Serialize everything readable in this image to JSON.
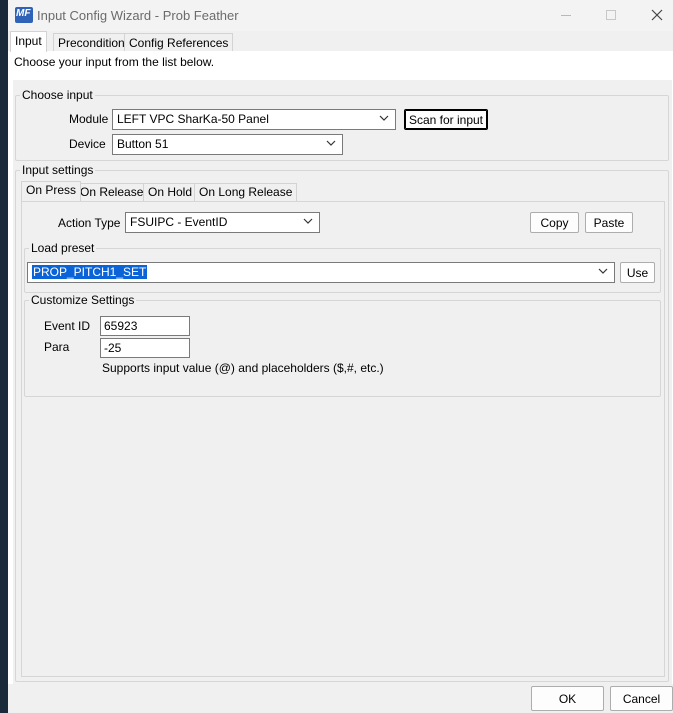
{
  "window": {
    "title": "Input Config Wizard - Prob Feather",
    "app_icon_text": "MF"
  },
  "tabs": [
    {
      "label": "Input"
    },
    {
      "label": "Precondition"
    },
    {
      "label": "Config References"
    }
  ],
  "instruction": "Choose your input from the list below.",
  "choose_input": {
    "title": "Choose input",
    "module_label": "Module",
    "module_value": "LEFT VPC SharKa-50 Panel",
    "scan_button": "Scan for input",
    "device_label": "Device",
    "device_value": "Button 51"
  },
  "input_settings": {
    "title": "Input settings",
    "tabs": [
      {
        "label": "On Press"
      },
      {
        "label": "On Release"
      },
      {
        "label": "On Hold"
      },
      {
        "label": "On Long Release"
      }
    ],
    "action_type_label": "Action Type",
    "action_type_value": "FSUIPC - EventID",
    "copy_button": "Copy",
    "paste_button": "Paste",
    "load_preset": {
      "title": "Load preset",
      "value": "PROP_PITCH1_SET",
      "use_button": "Use"
    },
    "customize": {
      "title": "Customize Settings",
      "event_id_label": "Event ID",
      "event_id_value": "65923",
      "para_label": "Para",
      "para_value": "-25",
      "hint": "Supports input value (@) and placeholders ($,#, etc.)"
    }
  },
  "footer": {
    "ok_button": "OK",
    "cancel_button": "Cancel"
  }
}
